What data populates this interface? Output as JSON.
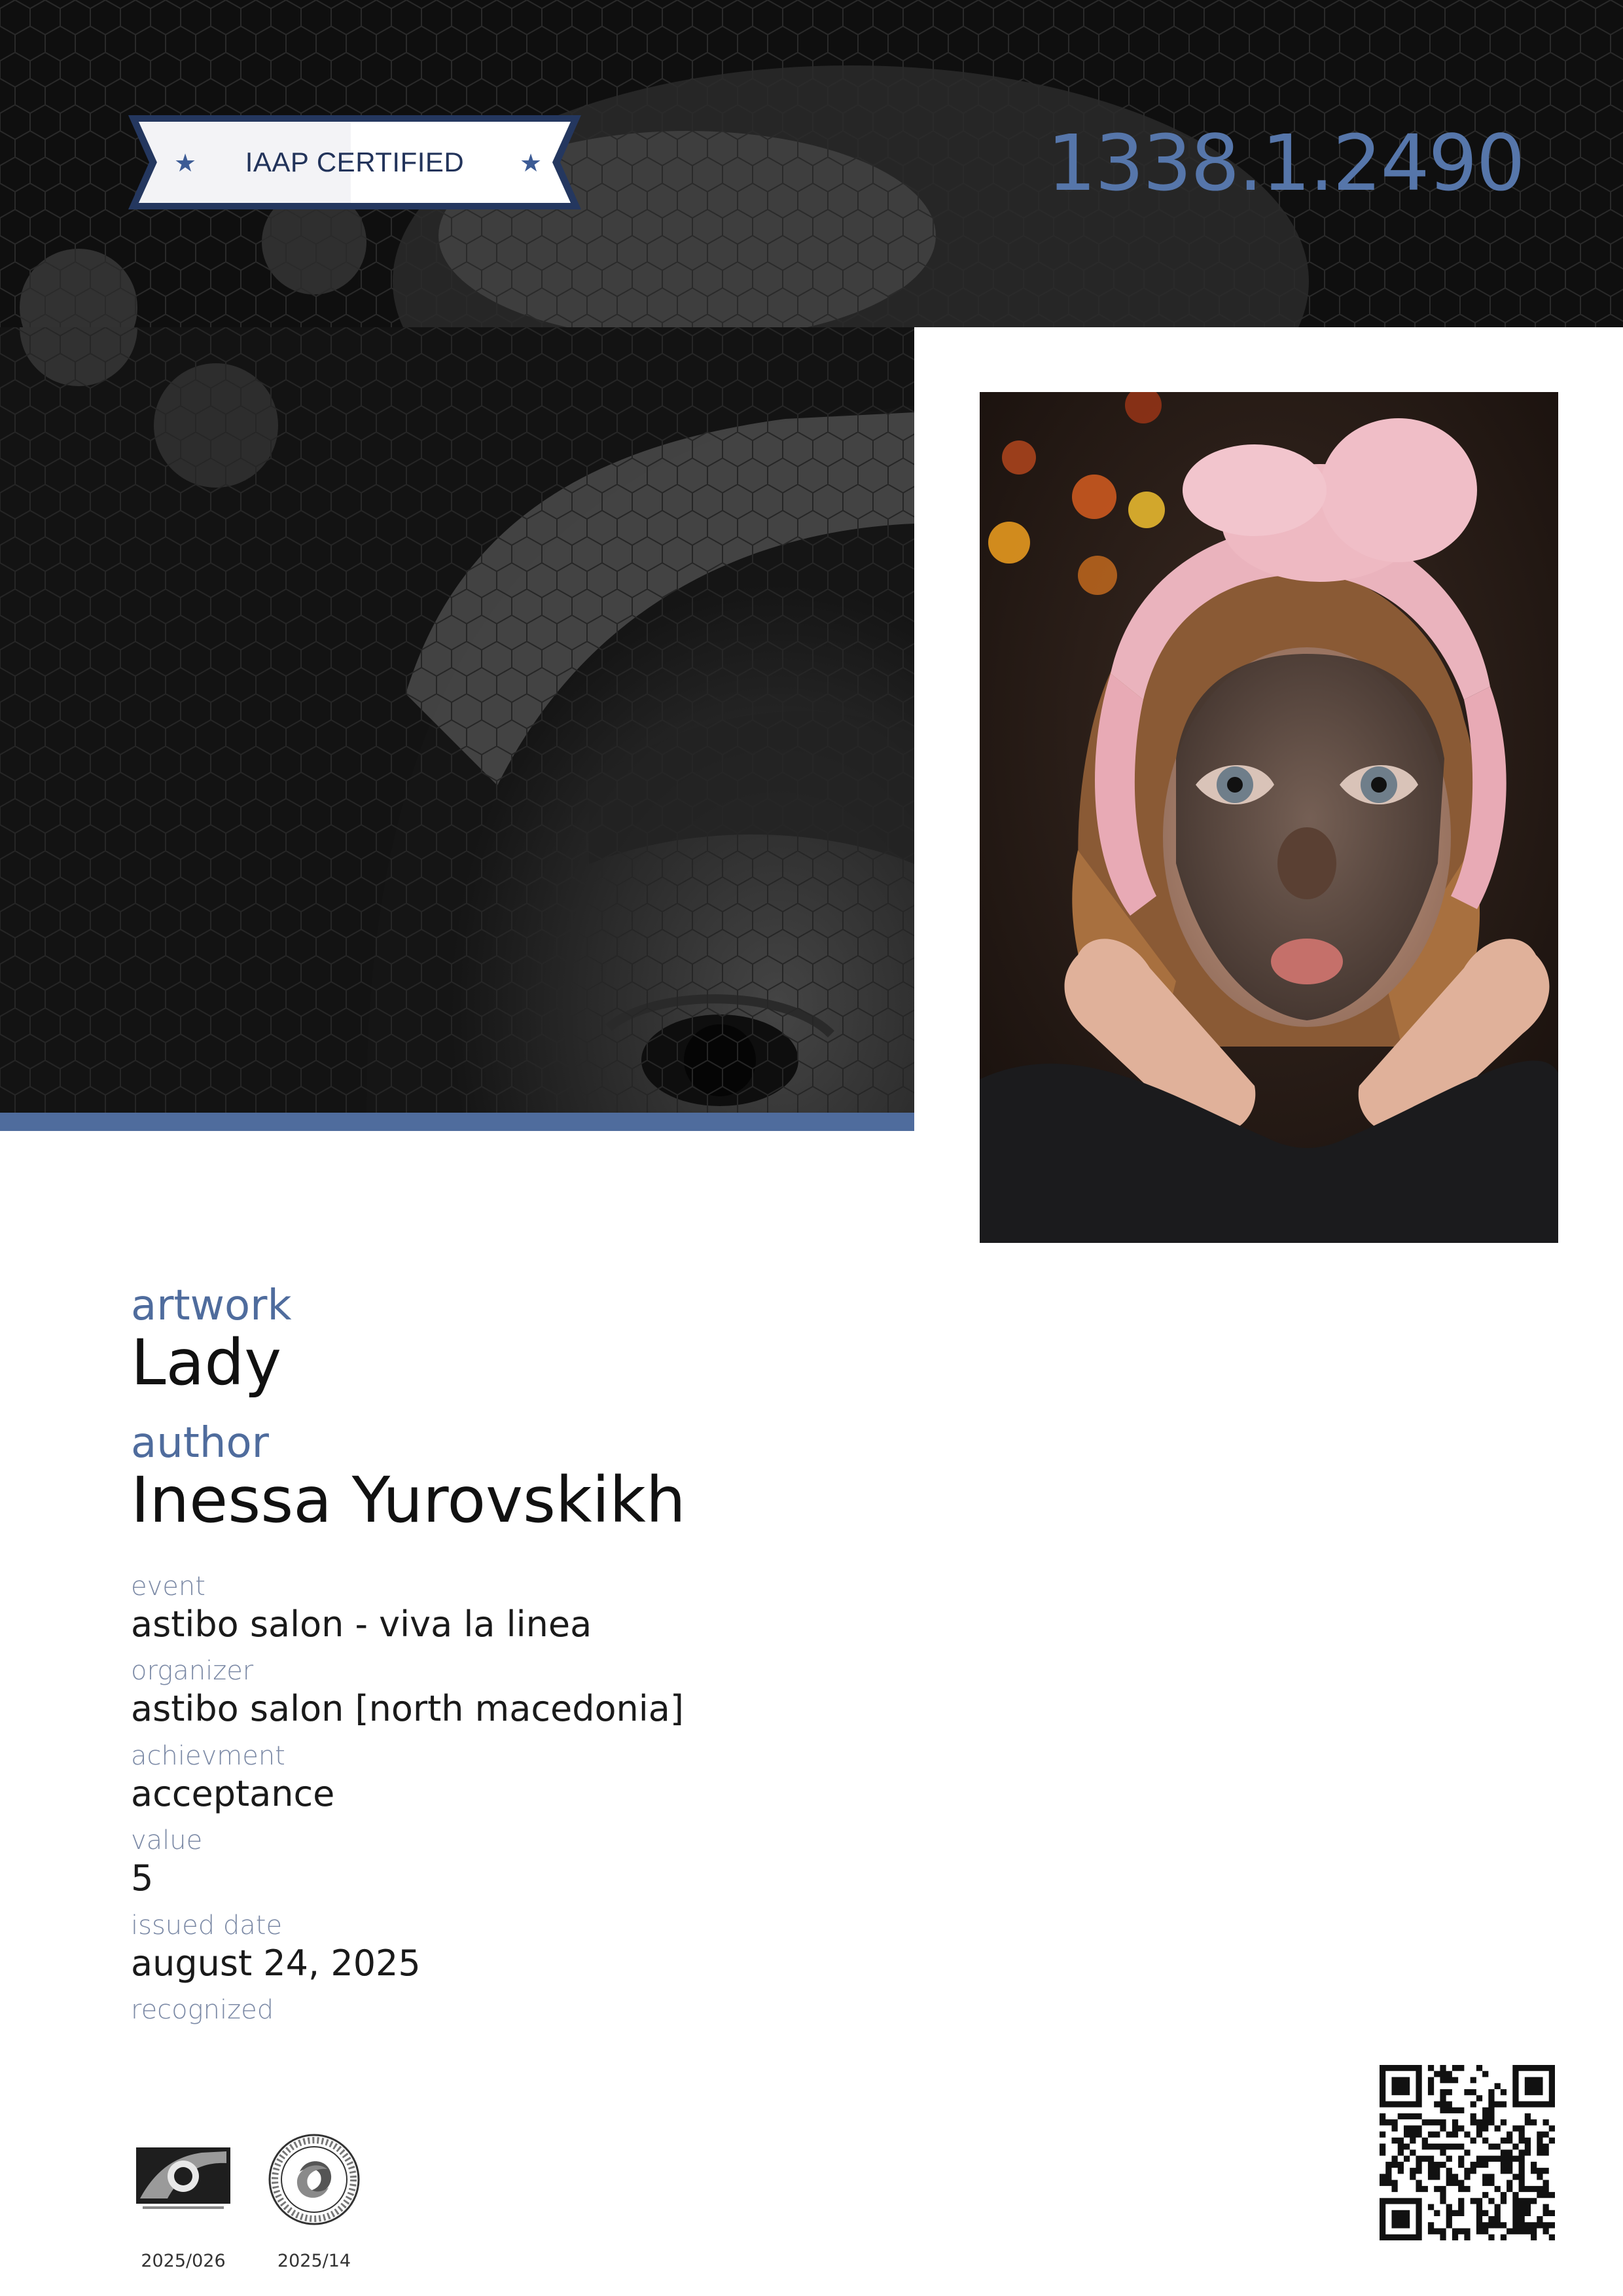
{
  "badge": {
    "label": "IAAP CERTIFIED"
  },
  "certificate": {
    "number": "1338.1.2490"
  },
  "fields": {
    "artwork_label": "artwork",
    "artwork": "Lady",
    "author_label": "author",
    "author": "Inessa Yurovskikh",
    "event_label": "event",
    "event": "astibo salon - viva la linea",
    "organizer_label": "organizer",
    "organizer": "astibo salon [north macedonia]",
    "achievement_label": "achievment",
    "achievement": "acceptance",
    "value_label": "value",
    "value": "5",
    "issued_label": "issued date",
    "issued": "august 24, 2025",
    "recognized_label": "recognized"
  },
  "recognitions": [
    {
      "code": "2025/026",
      "icon": "iaap-logo-icon"
    },
    {
      "code": "2025/14",
      "icon": "macedonian-photo-federation-seal-icon"
    }
  ],
  "colors": {
    "accent": "#4f6c9d",
    "number": "#5676aa",
    "badge_text": "#22335a",
    "background_dark": "#101010"
  }
}
